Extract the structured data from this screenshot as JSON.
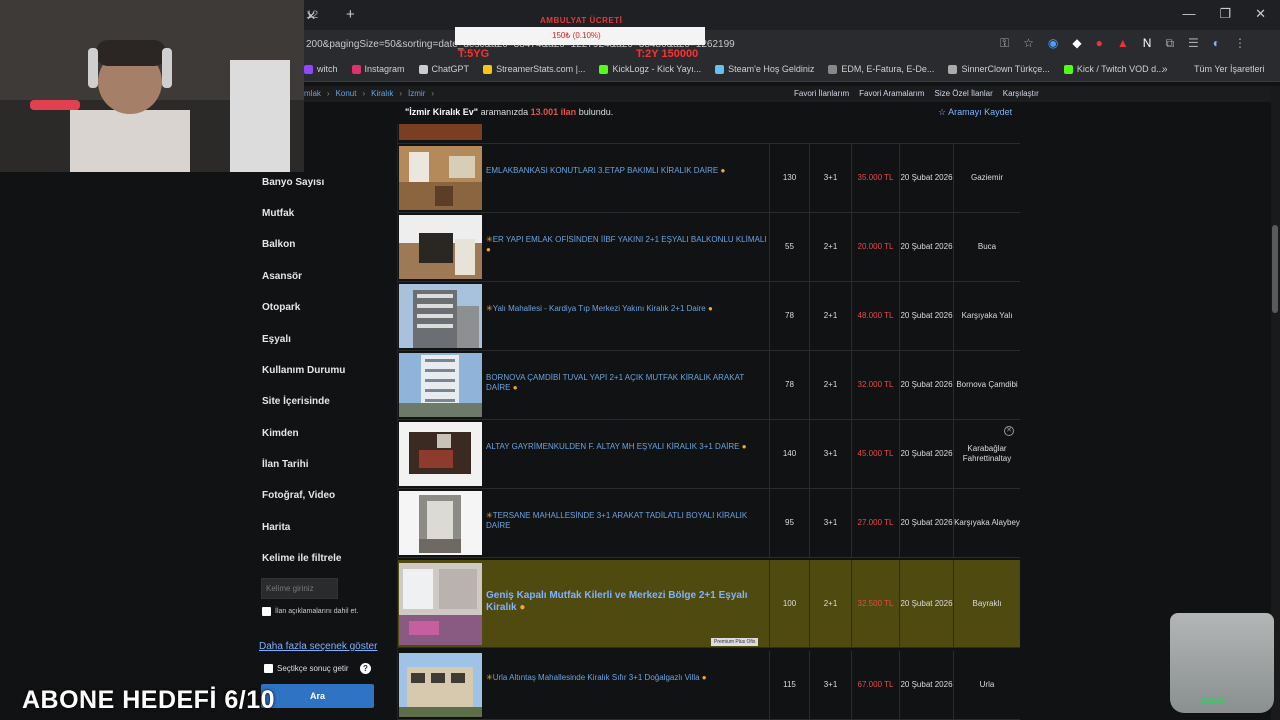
{
  "browser": {
    "tab_title": "12",
    "url": "200&pagingSize=50&sorting=date_desc&a20=38474&a20=1227924&a20=38486&a20=1262199",
    "bookmarks": [
      {
        "label": "witch",
        "color": "#9146ff"
      },
      {
        "label": "Instagram",
        "color": "#e1306c"
      },
      {
        "label": "ChatGPT",
        "color": "#cccccc"
      },
      {
        "label": "StreamerStats.com |...",
        "color": "#f5c518"
      },
      {
        "label": "KickLogz - Kick Yayı...",
        "color": "#53fc18"
      },
      {
        "label": "Steam'e Hoş Geldiniz",
        "color": "#66c0f4"
      },
      {
        "label": "EDM, E-Fatura, E-De...",
        "color": "#888888"
      },
      {
        "label": "SinnerClown Türkçe...",
        "color": "#aaaaaa"
      },
      {
        "label": "Kick / Twitch VOD d...",
        "color": "#53fc18"
      }
    ],
    "bookmarks_all": "Tüm Yer İşaretleri"
  },
  "overlay": {
    "title": "AMBULYAT ÜCRETİ",
    "progress": "150₺ (0.10%)",
    "left_text": "T:5YG",
    "right_text": "T:2Y 150000"
  },
  "breadcrumb": [
    "mlak",
    "Konut",
    "Kiralık",
    "İzmir"
  ],
  "top_links": [
    "Favori İlanlarım",
    "Favori Aramalarım",
    "Size Özel İlanlar",
    "Karşılaştır"
  ],
  "summary": {
    "query": "\"İzmir Kiralık Ev\"",
    "mid": "aramanızda",
    "count": "13.001 ilan",
    "end": "bulundu."
  },
  "save_search": "Aramayı Kaydet",
  "sidebar": {
    "items": [
      "Banyo Sayısı",
      "Mutfak",
      "Balkon",
      "Asansör",
      "Otopark",
      "Eşyalı",
      "Kullanım Durumu",
      "Site İçerisinde",
      "Kimden",
      "İlan Tarihi",
      "Fotoğraf, Video",
      "Harita",
      "Kelime ile filtrele"
    ],
    "keyword_placeholder": "Kelime giriniz",
    "desc_check_label": "İlan açıklamalarını dahil et.",
    "more_options": "Daha fazla seçenek göster",
    "selected_label": "Seçtikçe sonuç getir",
    "search_button": "Ara"
  },
  "listings": [
    {
      "title": "EMLAKBANKASI KONUTLARI 3.ETAP BAKIMLI KİRALIK DAİRE",
      "m2": "130",
      "rooms": "3+1",
      "price": "35.000 TL",
      "date": "20 Şubat 2026",
      "location": "Gaziemir",
      "star": false
    },
    {
      "title": "ER YAPI EMLAK OFİSİNDEN İİBF YAKINI 2+1 EŞYALI BALKONLU KLİMALI",
      "m2": "55",
      "rooms": "2+1",
      "price": "20.000 TL",
      "date": "20 Şubat 2026",
      "location": "Buca",
      "star": true
    },
    {
      "title": "Yalı Mahallesi - Kardiya Tıp Merkezi Yakını Kiralık 2+1 Daire",
      "m2": "78",
      "rooms": "2+1",
      "price": "48.000 TL",
      "date": "20 Şubat 2026",
      "location": "Karşıyaka Yalı",
      "star": true
    },
    {
      "title": "BORNOVA ÇAMDİBİ TUVAL YAPI 2+1 AÇIK MUTFAK KİRALIK ARAKAT DAİRE",
      "m2": "78",
      "rooms": "2+1",
      "price": "32.000 TL",
      "date": "20 Şubat 2026",
      "location": "Bornova Çamdibi",
      "star": false
    },
    {
      "title": "ALTAY GAYRİMENKULDEN F. ALTAY MH EŞYALI KİRALIK 3+1 DAİRE",
      "m2": "140",
      "rooms": "3+1",
      "price": "45.000 TL",
      "date": "20 Şubat 2026",
      "location": "Karabağlar Fahrettinaltay",
      "star": false
    },
    {
      "title": "TERSANE MAHALLESİNDE 3+1 ARAKAT TADİLATLI BOYALI KİRALIK DAİRE",
      "m2": "95",
      "rooms": "3+1",
      "price": "27.000 TL",
      "date": "20 Şubat 2026",
      "location": "Karşıyaka Alaybey",
      "star": true
    },
    {
      "title": "Geniş Kapalı Mutfak Kilerli ve Merkezi Bölge 2+1 Eşyalı Kiralık",
      "m2": "100",
      "rooms": "2+1",
      "price": "32.500 TL",
      "date": "20 Şubat 2026",
      "location": "Bayraklı",
      "star": false
    },
    {
      "title": "Urla Altıntaş Mahallesinde Kiralık Sıfır 3+1 Doğalgazlı Villa",
      "m2": "115",
      "rooms": "3+1",
      "price": "67.000 TL",
      "date": "20 Şubat 2026",
      "location": "Urla",
      "star": true
    }
  ],
  "premium_badge": "Premium Plus Ofis",
  "stream": {
    "goal_text": "ABONE HEDEFİ 6/10"
  },
  "colors": {
    "link": "#6aa3e0",
    "price": "#e84a4a",
    "premium_row": "#4f4a10",
    "search_button": "#2f73c4"
  }
}
